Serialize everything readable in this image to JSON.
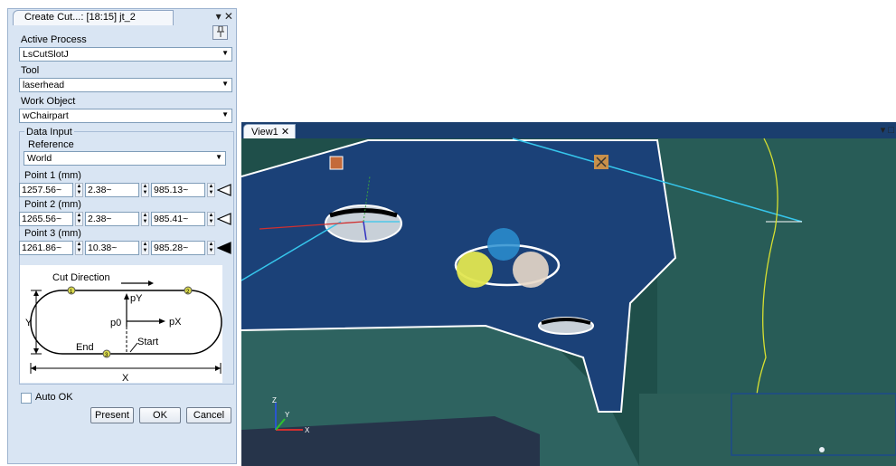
{
  "panel": {
    "tab_title": "Create Cut...: [18:15] jt_2",
    "tab_controls": "▾ ✕",
    "pin_icon": "pin",
    "active_process": {
      "label": "Active Process",
      "value": "LsCutSlotJ"
    },
    "tool": {
      "label": "Tool",
      "value": "laserhead"
    },
    "work_object": {
      "label": "Work Object",
      "value": "wChairpart"
    },
    "data_input": {
      "title": "Data Input",
      "reference_label": "Reference",
      "reference_value": "World",
      "points": [
        {
          "label": "Point 1 (mm)",
          "x": "1257.56~",
          "y": "2.38~",
          "z": "985.13~",
          "marker": "outline"
        },
        {
          "label": "Point 2 (mm)",
          "x": "1265.56~",
          "y": "2.38~",
          "z": "985.41~",
          "marker": "outline"
        },
        {
          "label": "Point 3 (mm)",
          "x": "1261.86~",
          "y": "10.38~",
          "z": "985.28~",
          "marker": "filled"
        }
      ]
    },
    "diagram": {
      "cut_direction": "Cut Direction",
      "p1": "1",
      "p2": "2",
      "p3": "3",
      "pY": "pY",
      "pX": "pX",
      "p0": "p0",
      "start": "Start",
      "end": "End",
      "x_dim": "X",
      "y_dim": "Y"
    },
    "auto_ok": {
      "label": "Auto OK",
      "checked": false
    },
    "buttons": {
      "present": "Present",
      "ok": "OK",
      "cancel": "Cancel"
    }
  },
  "viewport": {
    "tab_label": "View1",
    "tab_close": "✕",
    "window_controls": "▾ □",
    "axes": {
      "x": "X",
      "y": "Y",
      "z": "Z"
    }
  }
}
